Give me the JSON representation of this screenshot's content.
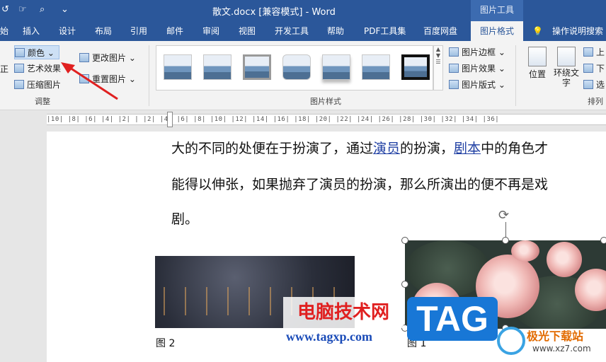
{
  "titlebar": {
    "title": "散文.docx [兼容模式]  -  Word",
    "context_group": "图片工具",
    "qat": {
      "undo": "↺",
      "touch": "☞",
      "preview": "⌕",
      "more": "⌄"
    }
  },
  "tabs": [
    {
      "label": "始",
      "active": false
    },
    {
      "label": "插入",
      "active": false
    },
    {
      "label": "设计",
      "active": false
    },
    {
      "label": "布局",
      "active": false
    },
    {
      "label": "引用",
      "active": false
    },
    {
      "label": "邮件",
      "active": false
    },
    {
      "label": "审阅",
      "active": false
    },
    {
      "label": "视图",
      "active": false
    },
    {
      "label": "开发工具",
      "active": false
    },
    {
      "label": "帮助",
      "active": false
    },
    {
      "label": "PDF工具集",
      "active": false
    },
    {
      "label": "百度网盘",
      "active": false
    },
    {
      "label": "图片格式",
      "active": true
    },
    {
      "label": "操作说明搜索",
      "active": false
    }
  ],
  "ribbon": {
    "adjust": {
      "correct_label": "正",
      "color_label": "颜色",
      "art_effects_label": "艺术效果",
      "compress_label": "压缩图片",
      "change_picture_label": "更改图片",
      "reset_picture_label": "重置图片",
      "group_label": "调整"
    },
    "styles": {
      "group_label": "图片样式",
      "border_label": "图片边框",
      "effects_label": "图片效果",
      "layout_label": "图片版式"
    },
    "arrange": {
      "position_label": "位置",
      "wrap_label": "环绕文字",
      "group_label": "排列",
      "up_label": "上",
      "down_label": "下",
      "select_label": "选"
    }
  },
  "ruler": {
    "ticks": "|10| |8| |6| |4| |2| | |2| |4| |6| |8| |10| |12| |14| |16| |18| |20| |22| |24| |26| |28| |30| |32| |34| |36|"
  },
  "document": {
    "line1_pre": "大的不同的处便在于扮演了，通过",
    "line1_link1": "演员",
    "line1_mid": "的扮演，",
    "line1_link2": "剧本",
    "line1_post": "中的角色才",
    "line2": "能得以伸张，如果抛弃了演员的扮演，那么所演出的便不再是戏",
    "line3": "剧。",
    "caption_left": "图 2",
    "caption_right": "图 1"
  },
  "watermarks": {
    "site_cn": "电脑技术网",
    "site_url": "www.tagxp.com",
    "tag_text": "TAG",
    "logo_name": "极光下载站",
    "logo_url": "www.xz7.com"
  },
  "colors": {
    "accent": "#2b579a",
    "arrow": "#e02020"
  }
}
